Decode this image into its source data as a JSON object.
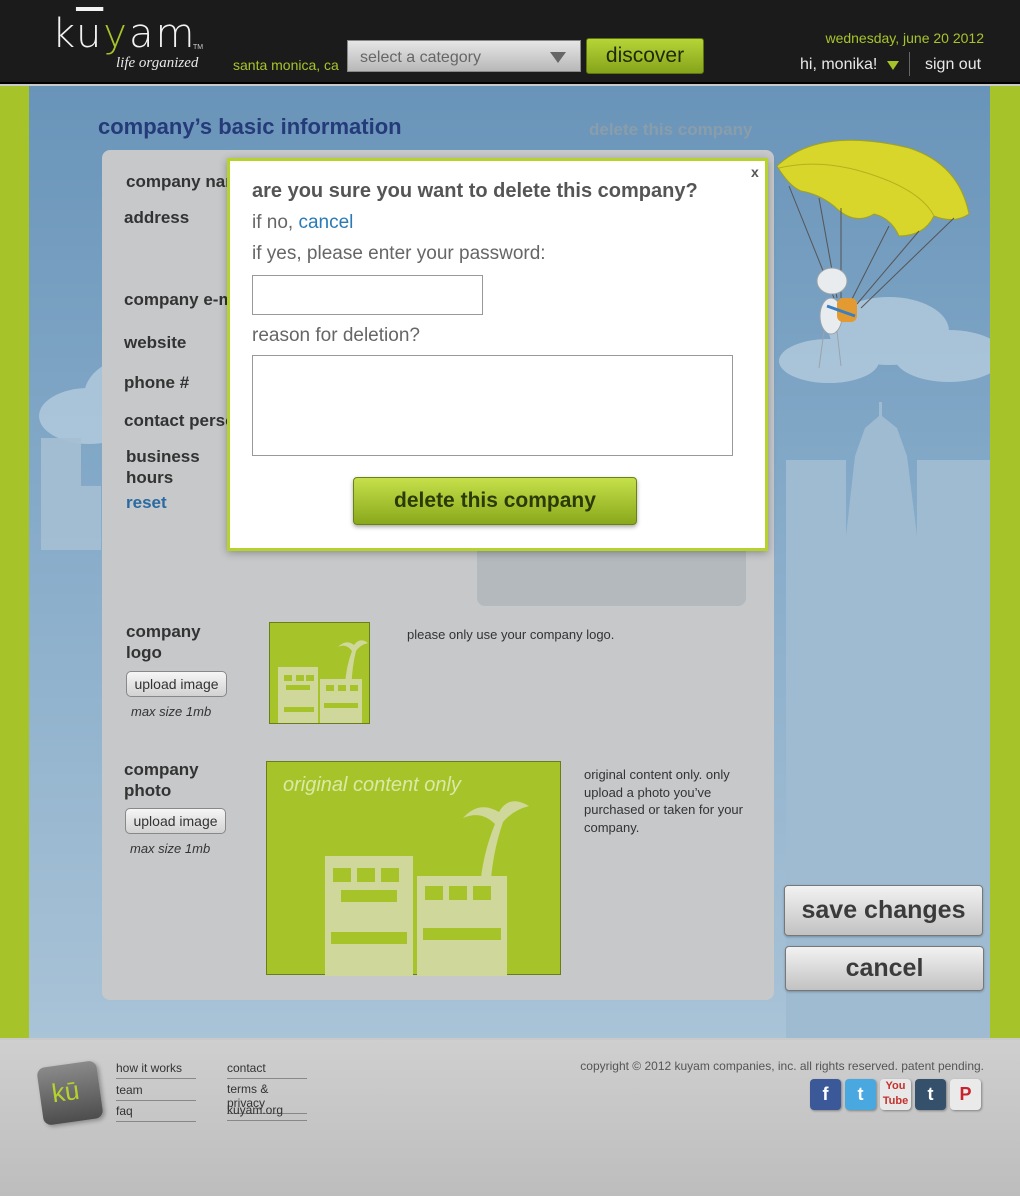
{
  "header": {
    "logo": "kuyam",
    "logo_tm": "TM",
    "tagline": "life organized",
    "location": "santa monica, ca",
    "category_placeholder": "select a category",
    "discover_label": "discover",
    "date": "wednesday, june 20 2012",
    "greeting": "hi, monika!",
    "signout_label": "sign out"
  },
  "page": {
    "heading": "company’s basic information",
    "delete_link": "delete this company",
    "fields": {
      "company_name": "company name",
      "address": "address",
      "company_email": "company e-mail",
      "website": "website",
      "phone": "phone #",
      "contact_person": "contact person",
      "business_hours": "business hours",
      "reset": "reset"
    },
    "logo_section": {
      "label": "company logo",
      "upload_label": "upload image",
      "max_size": "max size 1mb",
      "note": "please only use your company logo."
    },
    "photo_section": {
      "label": "company photo",
      "upload_label": "upload image",
      "max_size": "max size 1mb",
      "placeholder_caption": "original content only",
      "note": "original content only. only upload a photo you’ve purchased or taken for your company."
    },
    "save_label": "save changes",
    "cancel_label": "cancel"
  },
  "modal": {
    "close": "x",
    "question": "are you sure you want to delete this company?",
    "if_no": "if no,",
    "cancel_link": "cancel",
    "password_prompt": "if yes, please enter your password:",
    "password_value": "",
    "reason_prompt": "reason for deletion?",
    "reason_value": "",
    "confirm_label": "delete this company"
  },
  "footer": {
    "links_col1": [
      "how it works",
      "team",
      "faq"
    ],
    "links_col2": [
      "contact",
      "terms & privacy",
      "kuyam.org"
    ],
    "copyright": "copyright © 2012 kuyam companies, inc. all rights reserved. patent pending.",
    "social": [
      "facebook-icon",
      "twitter-icon",
      "youtube-icon",
      "tumblr-icon",
      "pinterest-icon"
    ]
  },
  "colors": {
    "brand_green": "#a6c42a",
    "header_bg": "#1b1b1b",
    "heading_blue": "#253a78",
    "link_blue": "#2a7ab5"
  }
}
